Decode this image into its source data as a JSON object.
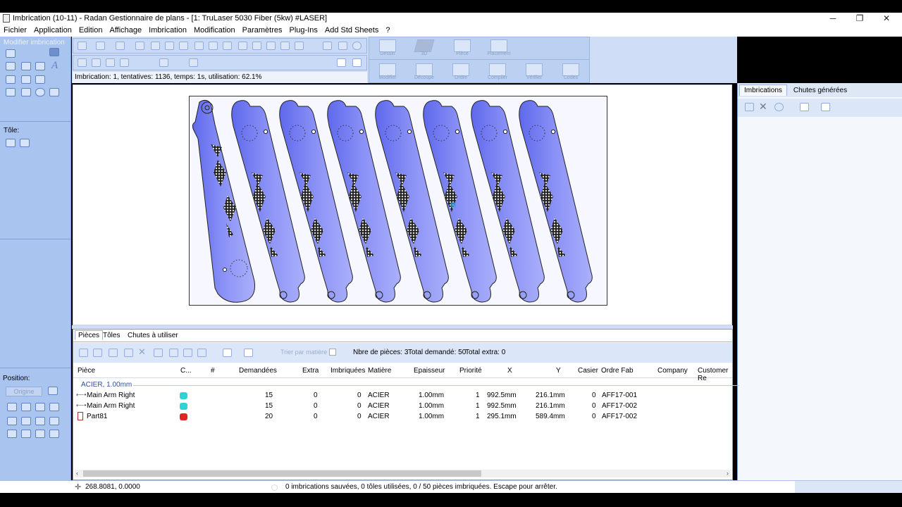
{
  "window": {
    "title": "Imbrication (10-11)  - Radan Gestionnaire de plans  - [1: TruLaser 5030 Fiber (5kw)                #LASER]",
    "controls": {
      "minimize": "─",
      "restore": "❐",
      "close": "✕"
    }
  },
  "menu": [
    "Fichier",
    "Application",
    "Edition",
    "Affichage",
    "Imbrication",
    "Modification",
    "Paramètres",
    "Plug-Ins",
    "Add Std Sheets",
    "?"
  ],
  "left_panel": {
    "title": "Modifier imbrication",
    "sheet_label": "Tôle:",
    "position_label": "Position:",
    "origin_button": "Origine"
  },
  "toolbar": {
    "status": "Imbrication: 1, tentatives: 1136, temps: 1s, utilisation: 62.1%"
  },
  "big_toolbar": {
    "row1": [
      "Dessin",
      "3D",
      "Pièce",
      "Placement"
    ],
    "row2": [
      "Modifier",
      "Découpe",
      "Ordre",
      "Compiler",
      "Vérifier",
      "Codes"
    ]
  },
  "right_panel": {
    "tabs": [
      "Imbrications",
      "Chutes générées"
    ]
  },
  "bottom_panel": {
    "tabs": [
      "Pièces",
      "Tôles",
      "Chutes à utiliser"
    ],
    "sort_label": "Trier par matière",
    "count_text": "Nbre de pièces: 3",
    "total_demanded": "Total demandé: 50",
    "total_extra": "Total extra: 0",
    "columns": [
      "Pièce",
      "C...",
      "#",
      "Demandées",
      "Extra",
      "Imbriquées",
      "Matière",
      "Epaisseur",
      "Priorité",
      "X",
      "Y",
      "Casier",
      "Ordre Fab",
      "Company",
      "Customer Re"
    ],
    "group": "ACIER, 1.00mm",
    "rows": [
      {
        "piece": "Main Arm Right",
        "color": "#2fd3d3",
        "demanded": "15",
        "extra": "0",
        "nested": "0",
        "material": "ACIER",
        "thickness": "1.00mm",
        "priority": "1",
        "x": "992.5mm",
        "y": "216.1mm",
        "casier": "0",
        "order": "AFF17-001"
      },
      {
        "piece": "Main Arm Right",
        "color": "#2fd3d3",
        "demanded": "15",
        "extra": "0",
        "nested": "0",
        "material": "ACIER",
        "thickness": "1.00mm",
        "priority": "1",
        "x": "992.5mm",
        "y": "216.1mm",
        "casier": "0",
        "order": "AFF17-002"
      },
      {
        "piece": "Part81",
        "color": "#e02424",
        "demanded": "20",
        "extra": "0",
        "nested": "0",
        "material": "ACIER",
        "thickness": "1.00mm",
        "priority": "1",
        "x": "295.1mm",
        "y": "589.4mm",
        "casier": "0",
        "order": "AFF17-002"
      }
    ]
  },
  "status": {
    "coords": "268.8081, 0.0000",
    "message": "0 imbrications sauvées, 0 tôles utilisées, 0 / 50 pièces imbriquées. Escape pour arrêter."
  },
  "colors": {
    "panel_blue": "#a9c4ef",
    "part_fill": "#6f79f0",
    "part_fill_light": "#8c93f5"
  }
}
